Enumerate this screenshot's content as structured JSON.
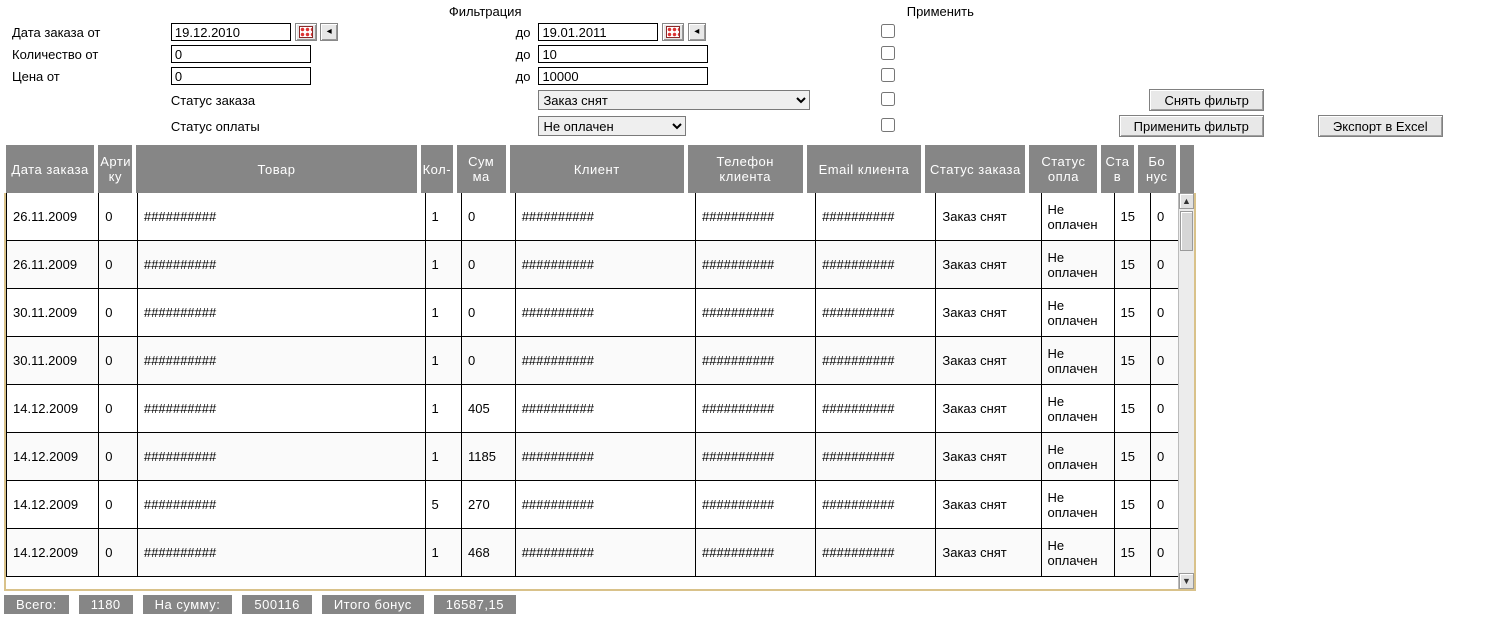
{
  "filters": {
    "section_label": "Фильтрация",
    "apply_label": "Применить",
    "row_date": {
      "from_label": "Дата заказа от",
      "to_label": "до",
      "from": "19.12.2010",
      "to": "19.01.2011"
    },
    "row_qty": {
      "from_label": "Количество от",
      "to_label": "до",
      "from": "0",
      "to": "10"
    },
    "row_price": {
      "from_label": "Цена от",
      "to_label": "до",
      "from": "0",
      "to": "10000"
    },
    "row_status": {
      "label": "Статус заказа",
      "value": "Заказ снят"
    },
    "row_pay": {
      "label": "Статус оплаты",
      "value": "Не оплачен"
    },
    "btn_clear": "Снять фильтр",
    "btn_apply": "Применить фильтр",
    "btn_export": "Экспорт в Excel"
  },
  "grid": {
    "columns": [
      "Дата заказа",
      "Арти ку",
      "Товар",
      "Кол-",
      "Сум ма",
      "Клиент",
      "Телефон клиента",
      "Email клиента",
      "Статус заказа",
      "Статус опла",
      "Ста в",
      "Бо нус"
    ],
    "widths": [
      86,
      36,
      268,
      34,
      50,
      168,
      112,
      112,
      98,
      68,
      34,
      40
    ],
    "rows": [
      [
        "26.11.2009",
        "0",
        "##########",
        "1",
        "0",
        "##########",
        "##########",
        "##########",
        "Заказ снят",
        "Не оплачен",
        "15",
        "0"
      ],
      [
        "26.11.2009",
        "0",
        "##########",
        "1",
        "0",
        "##########",
        "##########",
        "##########",
        "Заказ снят",
        "Не оплачен",
        "15",
        "0"
      ],
      [
        "30.11.2009",
        "0",
        "##########",
        "1",
        "0",
        "##########",
        "##########",
        "##########",
        "Заказ снят",
        "Не оплачен",
        "15",
        "0"
      ],
      [
        "30.11.2009",
        "0",
        "##########",
        "1",
        "0",
        "##########",
        "##########",
        "##########",
        "Заказ снят",
        "Не оплачен",
        "15",
        "0"
      ],
      [
        "14.12.2009",
        "0",
        "##########",
        "1",
        "405",
        "##########",
        "##########",
        "##########",
        "Заказ снят",
        "Не оплачен",
        "15",
        "0"
      ],
      [
        "14.12.2009",
        "0",
        "##########",
        "1",
        "1185",
        "##########",
        "##########",
        "##########",
        "Заказ снят",
        "Не оплачен",
        "15",
        "0"
      ],
      [
        "14.12.2009",
        "0",
        "##########",
        "5",
        "270",
        "##########",
        "##########",
        "##########",
        "Заказ снят",
        "Не оплачен",
        "15",
        "0"
      ],
      [
        "14.12.2009",
        "0",
        "##########",
        "1",
        "468",
        "##########",
        "##########",
        "##########",
        "Заказ снят",
        "Не оплачен",
        "15",
        "0"
      ]
    ]
  },
  "footer": {
    "total_label": "Всего:",
    "total_value": "1180",
    "sum_label": "На сумму:",
    "sum_value": "500116",
    "bonus_label": "Итого бонус",
    "bonus_value": "16587,15"
  }
}
